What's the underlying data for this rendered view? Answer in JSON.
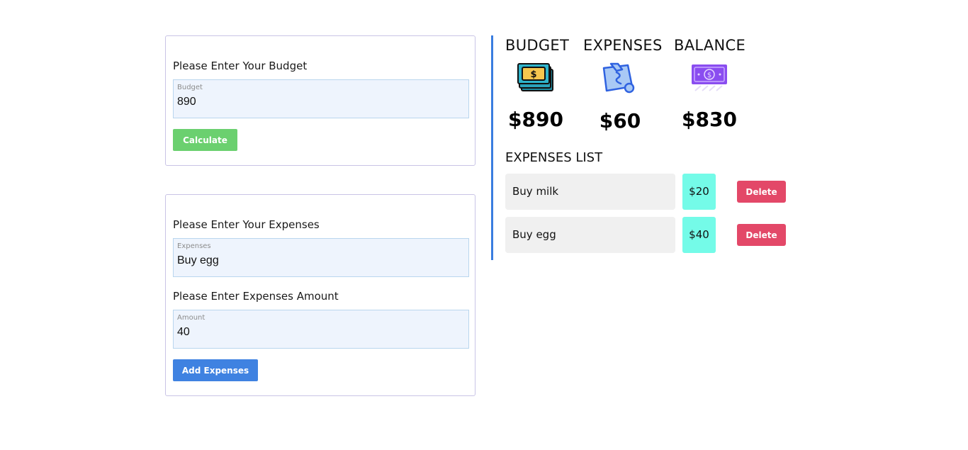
{
  "budget_form": {
    "title": "Please Enter Your Budget",
    "input_label": "Budget",
    "input_value": "890",
    "calculate_label": "Calculate"
  },
  "expense_form": {
    "title": "Please Enter Your Expenses",
    "input_label": "Expenses",
    "input_value": "Buy egg",
    "amount_title": "Please Enter Expenses Amount",
    "amount_label": "Amount",
    "amount_value": "40",
    "add_label": "Add Expenses"
  },
  "summary": {
    "budget": {
      "heading": "BUDGET",
      "value": "$890",
      "icon": "money-stack-icon"
    },
    "expenses": {
      "heading": "EXPENSES",
      "value": "$60",
      "icon": "credit-card-hand-icon"
    },
    "balance": {
      "heading": "BALANCE",
      "value": "$830",
      "icon": "dollar-bill-icon"
    }
  },
  "expenses_list": {
    "title": "EXPENSES LIST",
    "delete_label": "Delete",
    "items": [
      {
        "name": "Buy milk",
        "amount": "$20"
      },
      {
        "name": "Buy egg",
        "amount": "$40"
      }
    ]
  },
  "colors": {
    "calculate_button": "#6bd06f",
    "add_button": "#3f82e1",
    "delete_button": "#e34868",
    "amount_badge": "#74fbe8",
    "divider": "#3a7de0"
  }
}
